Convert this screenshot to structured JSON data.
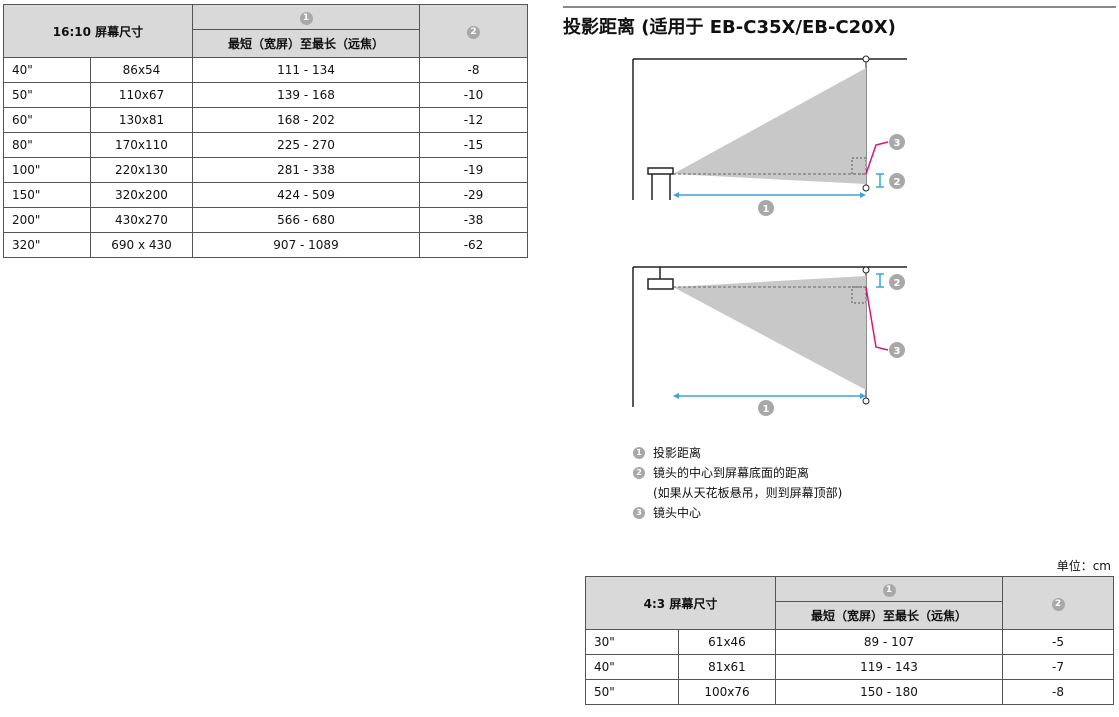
{
  "table_16_10": {
    "header_size": "16:10 屏幕尺寸",
    "header_col1_num": "1",
    "header_col1_sub": "最短（宽屏）至最长（远焦）",
    "header_col2_num": "2",
    "rows": [
      {
        "size": "40\"",
        "dims": "86x54",
        "range": "111 - 134",
        "offset": "-8"
      },
      {
        "size": "50\"",
        "dims": "110x67",
        "range": "139 - 168",
        "offset": "-10"
      },
      {
        "size": "60\"",
        "dims": "130x81",
        "range": "168 - 202",
        "offset": "-12"
      },
      {
        "size": "80\"",
        "dims": "170x110",
        "range": "225 - 270",
        "offset": "-15"
      },
      {
        "size": "100\"",
        "dims": "220x130",
        "range": "281 - 338",
        "offset": "-19"
      },
      {
        "size": "150\"",
        "dims": "320x200",
        "range": "424 - 509",
        "offset": "-29"
      },
      {
        "size": "200\"",
        "dims": "430x270",
        "range": "566 - 680",
        "offset": "-38"
      },
      {
        "size": "320\"",
        "dims": "690 x 430",
        "range": "907 - 1089",
        "offset": "-62"
      }
    ]
  },
  "section": {
    "title": "投影距离 (适用于 EB-C35X/EB-C20X)"
  },
  "diagram": {
    "callout_1": "1",
    "callout_2": "2",
    "callout_3": "3",
    "accent_color": "#e0157a",
    "arrow_color": "#3aa5d8"
  },
  "legend": {
    "item1_num": "1",
    "item1": "投影距离",
    "item2_num": "2",
    "item2": "镜头的中心到屏幕底面的距离",
    "item2_note": "(如果从天花板悬吊，则到屏幕顶部)",
    "item3_num": "3",
    "item3": "镜头中心"
  },
  "unit_label": "单位：cm",
  "table_4_3": {
    "header_size": "4:3 屏幕尺寸",
    "header_col1_num": "1",
    "header_col1_sub": "最短（宽屏）至最长（远焦）",
    "header_col2_num": "2",
    "rows": [
      {
        "size": "30\"",
        "dims": "61x46",
        "range": "89 - 107",
        "offset": "-5"
      },
      {
        "size": "40\"",
        "dims": "81x61",
        "range": "119 - 143",
        "offset": "-7"
      },
      {
        "size": "50\"",
        "dims": "100x76",
        "range": "150 - 180",
        "offset": "-8"
      }
    ]
  }
}
